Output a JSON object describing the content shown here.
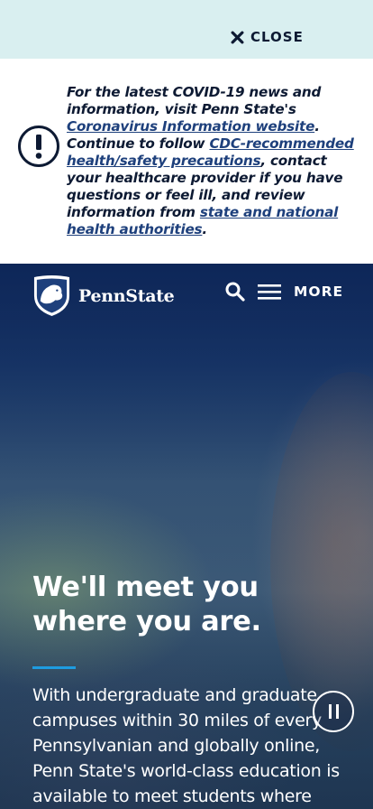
{
  "alert_bar": {
    "close_label": "CLOSE",
    "close_icon": "close-icon"
  },
  "alert": {
    "icon": "exclamation-circle-icon",
    "text_1": "For the latest COVID-19 news and information, visit Penn State's ",
    "link_1": "Coronavirus Information website",
    "text_2": ". Continue to follow ",
    "link_2": "CDC-recommended health/safety precautions",
    "text_3": ", contact your healthcare provider if you have questions or feel ill, and review information from ",
    "link_3": "state and national health authorities",
    "text_4": "."
  },
  "header": {
    "logo_text": "PennState",
    "logo_icon": "nittany-lion-shield-icon",
    "search_icon": "search-icon",
    "menu_icon": "hamburger-menu-icon",
    "more_label": "MORE"
  },
  "hero": {
    "headline": "We'll meet you where you are.",
    "body": "With undergraduate and graduate campuses within 30 miles of every Pennsylvanian and globally online, Penn State's world-class education is available to meet students where",
    "pause_icon": "pause-icon",
    "accent_color": "#1e9ce0"
  },
  "colors": {
    "brand_navy": "#1e407c",
    "alert_bg": "#d9eff0"
  }
}
